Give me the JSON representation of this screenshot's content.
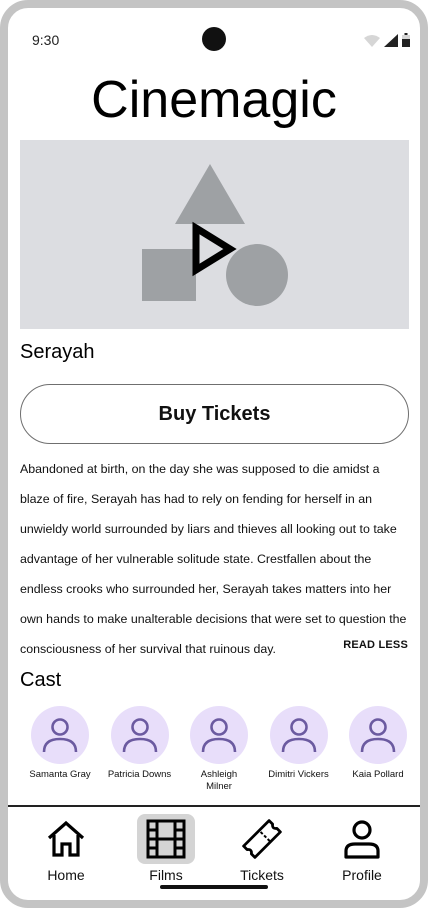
{
  "status_bar": {
    "time": "9:30"
  },
  "app": {
    "title": "Cinemagic"
  },
  "film": {
    "title": "Serayah",
    "buy_label": "Buy Tickets",
    "synopsis": "Abandoned at birth, on the day she was supposed to die amidst a blaze of fire, Serayah has had to rely on fending for herself in an unwieldy world surrounded by liars and thieves all looking out to take advantage of her vulnerable solitude state. Crestfallen about the endless crooks who surrounded her, Serayah takes matters into her own hands to make unalterable decisions that were set to question the consciousness of her survival that ruinous day.",
    "read_less_label": "READ LESS"
  },
  "cast": {
    "heading": "Cast",
    "members": [
      {
        "name": "Samanta Gray"
      },
      {
        "name": "Patricia Downs"
      },
      {
        "name": "Ashleigh Milner"
      },
      {
        "name": "Dimitri Vickers"
      },
      {
        "name": "Kaia Pollard"
      }
    ]
  },
  "bottom_nav": {
    "items": [
      {
        "label": "Home",
        "icon": "home-icon",
        "active": false
      },
      {
        "label": "Films",
        "icon": "film-icon",
        "active": true
      },
      {
        "label": "Tickets",
        "icon": "ticket-icon",
        "active": false
      },
      {
        "label": "Profile",
        "icon": "person-icon",
        "active": false
      }
    ]
  },
  "colors": {
    "media_background": "#dcdde1",
    "placeholder_shapes": "#9ea1a4",
    "avatar_background": "#e8defa",
    "avatar_icon": "#6b5aa0",
    "active_nav_background": "#d4d4d4"
  }
}
